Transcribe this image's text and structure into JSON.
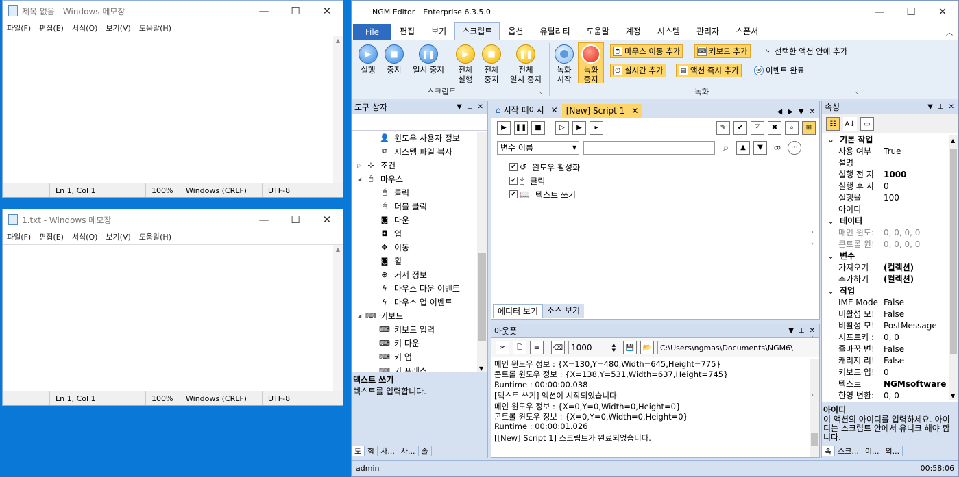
{
  "np1": {
    "title": "제목 없음 - Windows 메모장",
    "menu": [
      "파일(F)",
      "편집(E)",
      "서식(O)",
      "보기(V)",
      "도움말(H)"
    ],
    "status": {
      "pos": "Ln 1, Col 1",
      "zoom": "100%",
      "eol": "Windows (CRLF)",
      "enc": "UTF-8"
    }
  },
  "np2": {
    "title": "1.txt - Windows 메모장",
    "menu": [
      "파일(F)",
      "편집(E)",
      "서식(O)",
      "보기(V)",
      "도움말(H)"
    ],
    "status": {
      "pos": "Ln 1, Col 1",
      "zoom": "100%",
      "eol": "Windows (CRLF)",
      "enc": "UTF-8"
    }
  },
  "ngm": {
    "title": "NGM Editor",
    "edition": "Enterprise 6.3.5.0",
    "tabs": [
      "File",
      "편집",
      "보기",
      "스크립트",
      "옵션",
      "유틸리티",
      "도움말",
      "계정",
      "시스템",
      "관리자",
      "스폰서"
    ],
    "ribbon": {
      "run": "실행",
      "stop": "중지",
      "pause": "일시 중지",
      "all_run_a": "전체",
      "all_run_b": "실행",
      "all_stop_a": "전체",
      "all_stop_b": "중지",
      "all_pause_a": "전체",
      "all_pause_b": "일시 중지",
      "script_group": "스크립트",
      "rec_start_a": "녹화",
      "rec_start_b": "시작",
      "rec_stop_a": "녹화",
      "rec_stop_b": "중지",
      "mouse_move": "마우스 이동 추가",
      "keyboard": "키보드 추가",
      "selected": "선택한 액션 안에 추가",
      "realtime": "실시간 추가",
      "instant": "액션 즉시 추가",
      "event_done": "이벤트 완료",
      "rec_group": "녹화"
    },
    "toolbox": {
      "title": "도구 상자",
      "items": [
        {
          "icon": "person-icon",
          "label": "윈도우 사용자 정보",
          "level": 2
        },
        {
          "icon": "copy-icon",
          "label": "시스템 파일 복사",
          "level": 2
        },
        {
          "icon": "branch-icon",
          "label": "조건",
          "level": 1,
          "exp": "▷"
        },
        {
          "icon": "mouse-icon",
          "label": "마우스",
          "level": 1,
          "exp": "◢"
        },
        {
          "icon": "click-icon",
          "label": "클릭",
          "level": 2
        },
        {
          "icon": "double-click-icon",
          "label": "더블 클릭",
          "level": 2
        },
        {
          "icon": "mouse-down-icon",
          "label": "다운",
          "level": 2
        },
        {
          "icon": "mouse-up-icon",
          "label": "업",
          "level": 2
        },
        {
          "icon": "move-icon",
          "label": "이동",
          "level": 2
        },
        {
          "icon": "wheel-icon",
          "label": "휠",
          "level": 2
        },
        {
          "icon": "cursor-info-icon",
          "label": "커서 정보",
          "level": 2
        },
        {
          "icon": "bolt-icon",
          "label": "마우스 다운 이벤트",
          "level": 2
        },
        {
          "icon": "bolt-icon",
          "label": "마우스 업 이벤트",
          "level": 2
        },
        {
          "icon": "keyboard-icon",
          "label": "키보드",
          "level": 1,
          "exp": "◢"
        },
        {
          "icon": "keyboard-icon",
          "label": "키보드 입력",
          "level": 2
        },
        {
          "icon": "keyboard-icon",
          "label": "키 다운",
          "level": 2
        },
        {
          "icon": "keyboard-icon",
          "label": "키 업",
          "level": 2
        },
        {
          "icon": "keyboard-icon",
          "label": "키 프레스",
          "level": 2
        }
      ],
      "desc_title": "텍스트 쓰기",
      "desc": "텍스트를 입력합니다.",
      "tabs": [
        "도",
        "함",
        "사...",
        "사...",
        "졸"
      ]
    },
    "doc": {
      "tab1": "시작 페이지",
      "tab2": "[New] Script 1",
      "var_select": "변수 이름",
      "actions": [
        "윈도우 활성화",
        "클릭",
        "텍스트 쓰기"
      ],
      "view1": "에디터 보기",
      "view2": "소스 보기"
    },
    "output": {
      "title": "아웃풋",
      "count": "1000",
      "path": "C:\\Users\\ngmas\\Documents\\NGM6\\",
      "lines": [
        "메인 윈도우 정보 : {X=130,Y=480,Width=645,Height=775}",
        "콘트롤 윈도우 정보 : {X=138,Y=531,Width=637,Height=745}",
        "Runtime : 00:00:00.038",
        "[텍스트 쓰기] 액션이 시작되었습니다.",
        "메인 윈도우 정보 : {X=0,Y=0,Width=0,Height=0}",
        "콘트롤 윈도우 정보 : {X=0,Y=0,Width=0,Height=0}",
        "Runtime : 00:00:01.026",
        "[[New] Script 1] 스크립트가 완료되었습니다."
      ]
    },
    "props": {
      "title": "속성",
      "rows": [
        {
          "cat": "기본 작업"
        },
        {
          "k": "사용 여부",
          "v": "True"
        },
        {
          "k": "설명",
          "v": ""
        },
        {
          "k": "실행 전 지",
          "v": "1000",
          "b": true
        },
        {
          "k": "실행 후 지",
          "v": "0"
        },
        {
          "k": "실행율",
          "v": "100"
        },
        {
          "k": "아이디",
          "v": ""
        },
        {
          "cat": "데이터"
        },
        {
          "k": "매인 윈도:",
          "v": "0, 0, 0, 0",
          "exp": true,
          "g": true
        },
        {
          "k": "콘트롤 윈!",
          "v": "0, 0, 0, 0",
          "exp": true,
          "g": true
        },
        {
          "cat": "변수"
        },
        {
          "k": "가져오기",
          "v": "(컬렉션)",
          "b": true
        },
        {
          "k": "추가하기",
          "v": "(컬렉션)",
          "b": true
        },
        {
          "cat": "작업"
        },
        {
          "k": "IME Mode",
          "v": "False"
        },
        {
          "k": "비활성 모!",
          "v": "False"
        },
        {
          "k": "비활성 모!",
          "v": "PostMessage"
        },
        {
          "k": "시프트키 :",
          "v": "0, 0",
          "exp": true
        },
        {
          "k": "줄바꿈 변!",
          "v": "False"
        },
        {
          "k": "캐리지 리!",
          "v": "False"
        },
        {
          "k": "키보드 입!",
          "v": "0"
        },
        {
          "k": "텍스트",
          "v": "NGMsoftware",
          "b": true
        },
        {
          "k": "한영 변환:",
          "v": "0, 0",
          "exp": true
        }
      ],
      "desc_title": "아이디",
      "desc": "이 액션의 아이디를 입력하세요. 아이디는 스크립트 안에서 유니크 해야 합니다.",
      "tabs": [
        "속",
        "스크...",
        "이...",
        "외..."
      ]
    },
    "status": {
      "user": "admin",
      "time": "00:58:06"
    }
  }
}
